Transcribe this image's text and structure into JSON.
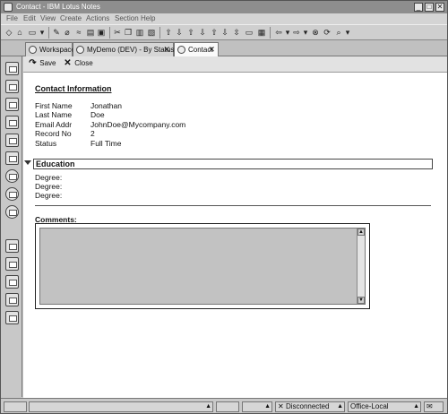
{
  "window": {
    "title": "Contact - IBM Lotus Notes",
    "minimize_glyph": "_",
    "restore_glyph": "□",
    "close_glyph": "✕"
  },
  "menu": [
    "File",
    "Edit",
    "View",
    "Create",
    "Actions",
    "Section",
    "Help"
  ],
  "tabs": [
    {
      "label": "Workspace",
      "icon": "workspace-icon",
      "closable": false
    },
    {
      "label": "MyDemo (DEV) - By Status",
      "icon": "database-icon",
      "closable": true
    },
    {
      "label": "Contact",
      "icon": "document-icon",
      "closable": true,
      "active": true
    }
  ],
  "actions": {
    "save_label": "Save",
    "close_label": "Close"
  },
  "form": {
    "heading": "Contact Information",
    "fields": [
      {
        "label": "First Name",
        "value": "Jonathan"
      },
      {
        "label": "Last Name",
        "value": "Doe"
      },
      {
        "label": "Email Addr",
        "value": "JohnDoe@Mycompany.com"
      },
      {
        "label": "Record No",
        "value": "2"
      },
      {
        "label": "Status",
        "value": "Full Time"
      }
    ],
    "section_title": "Education",
    "degrees": [
      "Degree:",
      "Degree:",
      "Degree:"
    ],
    "comments_label": "Comments:"
  },
  "statusbar": {
    "location": "Disconnected",
    "server": "Office-Local"
  },
  "colors": {
    "chrome": "#c9c9c9",
    "titlebar": "#8e8e8e",
    "document": "#ffffff",
    "comments_field": "#c2c2c2"
  }
}
